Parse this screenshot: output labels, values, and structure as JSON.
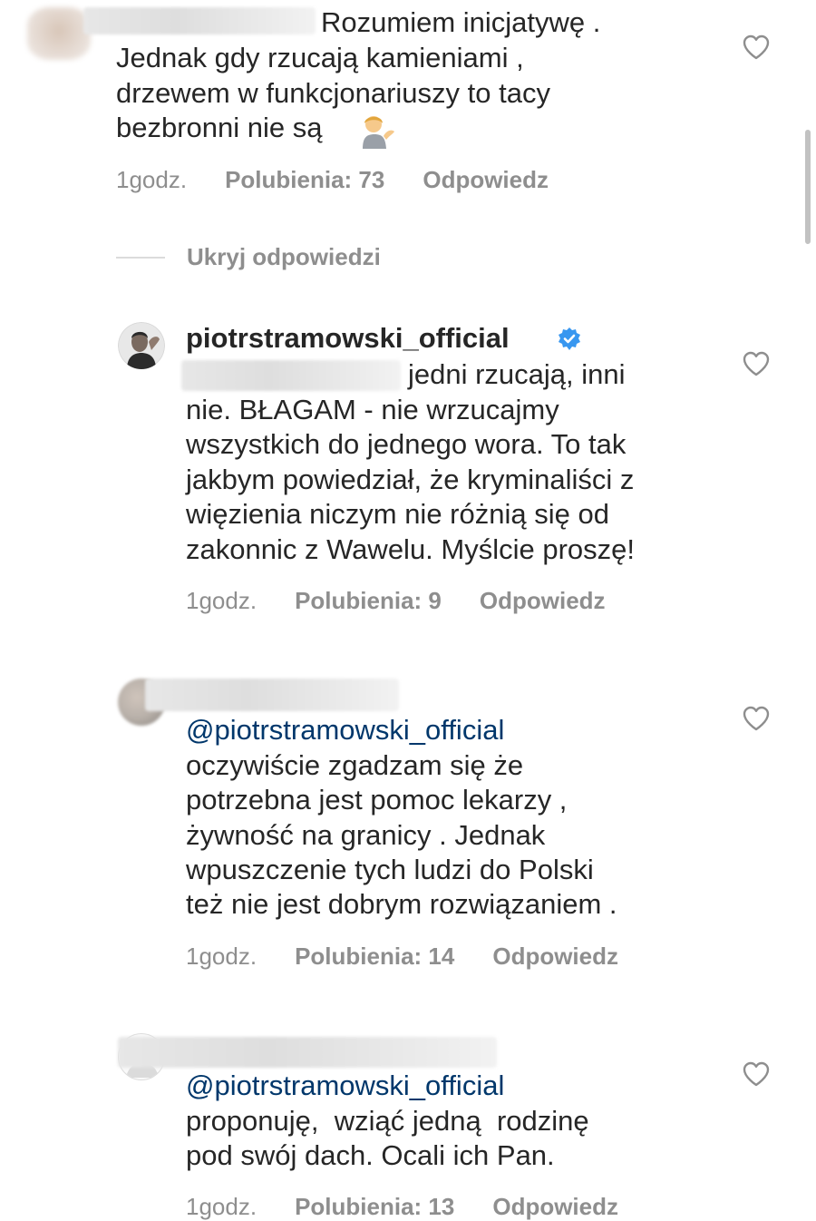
{
  "comments": [
    {
      "lines": [
        "Rozumiem inicjatywę .",
        "Jednak gdy rzucają kamieniami ,",
        "drzewem w funkcjonariuszy to tacy",
        "bezbronni nie są"
      ],
      "emoji": "person-tipping-hand",
      "time": "1godz.",
      "likes": "Polubienia: 73",
      "reply": "Odpowiedz"
    },
    {
      "username": "piotrstramowski_official",
      "verified": true,
      "lines": [
        "jedni rzucają, inni",
        "nie. BŁAGAM - nie wrzucajmy",
        "wszystkich do jednego wora. To tak",
        "jakbym powiedział, że kryminaliści z",
        "więzienia niczym nie różnią się od",
        "zakonnic z Wawelu. Myślcie proszę!"
      ],
      "time": "1godz.",
      "likes": "Polubienia: 9",
      "reply": "Odpowiedz"
    },
    {
      "mention": "@piotrstramowski_official",
      "lines": [
        "oczywiście zgadzam się że",
        "potrzebna jest pomoc lekarzy ,",
        "żywność na granicy . Jednak",
        "wpuszczenie tych ludzi do Polski",
        "też nie jest dobrym rozwiązaniem ."
      ],
      "time": "1godz.",
      "likes": "Polubienia: 14",
      "reply": "Odpowiedz"
    },
    {
      "mention": "@piotrstramowski_official",
      "lines": [
        "proponuję,  wziąć jedną  rodzinę",
        "pod swój dach. Ocali ich Pan."
      ],
      "time": "1godz.",
      "likes": "Polubienia: 13",
      "reply": "Odpowiedz"
    }
  ],
  "hide_replies": "Ukryj odpowiedzi",
  "colors": {
    "text": "#262626",
    "secondary": "#8e8e8e",
    "mention": "#00376b",
    "verified": "#3897f0"
  },
  "icons": [
    "heart-outline-icon",
    "verified-badge-icon"
  ]
}
